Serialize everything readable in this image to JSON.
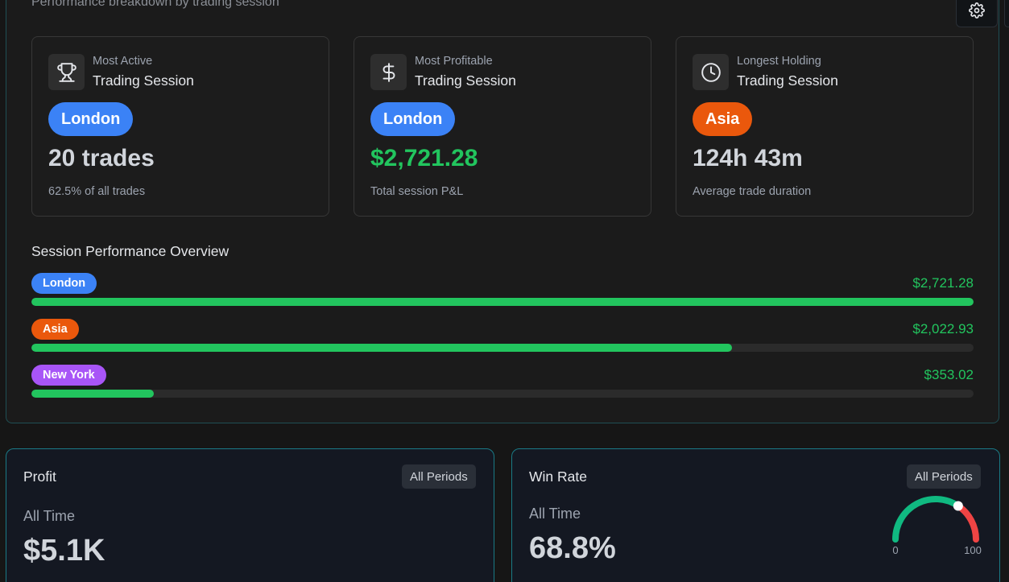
{
  "header": {
    "subtitle": "Performance breakdown by trading session",
    "settings_icon": "gear-icon"
  },
  "cards": [
    {
      "icon": "trophy-icon",
      "label": "Most Active",
      "title": "Trading Session",
      "badge": "London",
      "badge_color": "#3b82f6",
      "value": "20 trades",
      "note": "62.5% of all trades"
    },
    {
      "icon": "dollar-icon",
      "label": "Most Profitable",
      "title": "Trading Session",
      "badge": "London",
      "badge_color": "#3b82f6",
      "value": "$2,721.28",
      "note": "Total session P&L"
    },
    {
      "icon": "clock-icon",
      "label": "Longest Holding",
      "title": "Trading Session",
      "badge": "Asia",
      "badge_color": "#ea580c",
      "value": "124h 43m",
      "note": "Average trade duration"
    }
  ],
  "overview": {
    "title": "Session Performance Overview",
    "rows": [
      {
        "session": "London",
        "color": "#3b82f6",
        "amount": "$2,721.28",
        "fraction": 1.0
      },
      {
        "session": "Asia",
        "color": "#ea580c",
        "amount": "$2,022.93",
        "fraction": 0.744
      },
      {
        "session": "New York",
        "color": "#a855f7",
        "amount": "$353.02",
        "fraction": 0.13
      }
    ],
    "bar_color": "#22c55e"
  },
  "profit": {
    "title": "Profit",
    "period": "All Periods",
    "subtitle": "All Time",
    "value": "$5.1K"
  },
  "win_rate": {
    "title": "Win Rate",
    "period": "All Periods",
    "subtitle": "All Time",
    "value": "68.8%",
    "gauge": {
      "min_label": "0",
      "max_label": "100",
      "value": 68.8,
      "good_color": "#10b981",
      "bad_color": "#ef4444"
    }
  }
}
